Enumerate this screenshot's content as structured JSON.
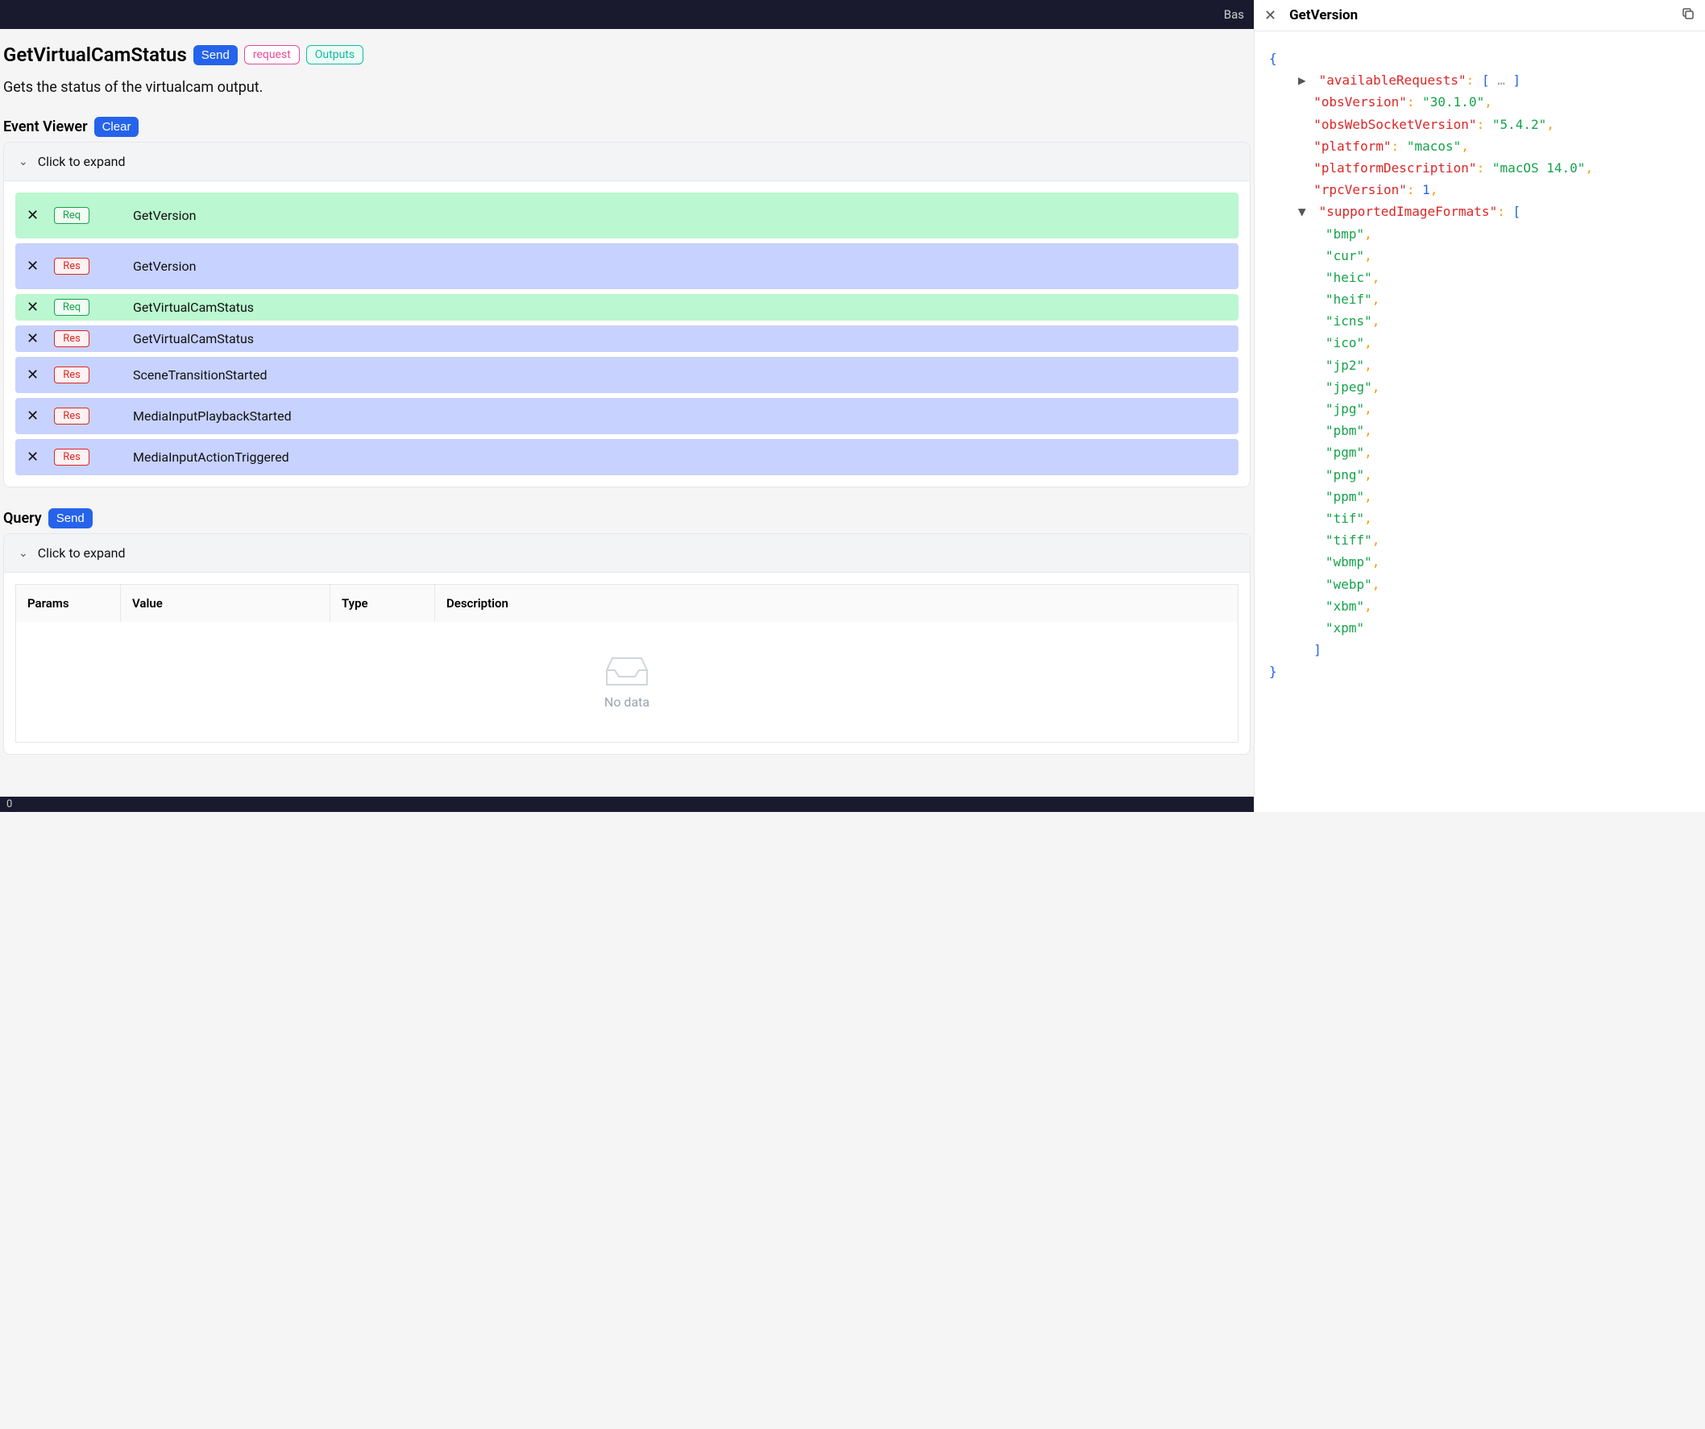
{
  "topbar": {
    "right_text": "Bas"
  },
  "header": {
    "title": "GetVirtualCamStatus",
    "send_label": "Send",
    "request_tag": "request",
    "outputs_tag": "Outputs",
    "description": "Gets the status of the virtualcam output."
  },
  "event_viewer": {
    "title": "Event Viewer",
    "clear_label": "Clear",
    "expand_label": "Click to expand"
  },
  "badges": {
    "req": "Req",
    "res": "Res"
  },
  "events": [
    {
      "type": "req",
      "name": "GetVersion",
      "size": "tall"
    },
    {
      "type": "res",
      "name": "GetVersion",
      "size": "tall"
    },
    {
      "type": "req",
      "name": "GetVirtualCamStatus",
      "size": "short"
    },
    {
      "type": "res",
      "name": "GetVirtualCamStatus",
      "size": "short"
    },
    {
      "type": "res",
      "name": "SceneTransitionStarted",
      "size": ""
    },
    {
      "type": "res",
      "name": "MediaInputPlaybackStarted",
      "size": ""
    },
    {
      "type": "res",
      "name": "MediaInputActionTriggered",
      "size": ""
    }
  ],
  "query": {
    "title": "Query",
    "send_label": "Send",
    "expand_label": "Click to expand",
    "columns": {
      "params": "Params",
      "value": "Value",
      "type": "Type",
      "description": "Description"
    },
    "empty": "No data"
  },
  "bottombar": {
    "text": "0"
  },
  "detail": {
    "title": "GetVersion",
    "json": {
      "availableRequests_key": "availableRequests",
      "obsVersion_key": "obsVersion",
      "obsVersion_val": "30.1.0",
      "obsWebSocketVersion_key": "obsWebSocketVersion",
      "obsWebSocketVersion_val": "5.4.2",
      "platform_key": "platform",
      "platform_val": "macos",
      "platformDescription_key": "platformDescription",
      "platformDescription_val": "macOS 14.0",
      "rpcVersion_key": "rpcVersion",
      "rpcVersion_val": "1",
      "supportedImageFormats_key": "supportedImageFormats",
      "formats": [
        "bmp",
        "cur",
        "heic",
        "heif",
        "icns",
        "ico",
        "jp2",
        "jpeg",
        "jpg",
        "pbm",
        "pgm",
        "png",
        "ppm",
        "tif",
        "tiff",
        "wbmp",
        "webp",
        "xbm",
        "xpm"
      ]
    }
  }
}
